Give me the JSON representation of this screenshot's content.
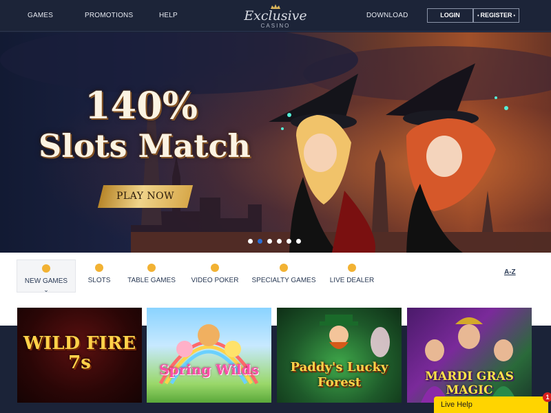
{
  "header": {
    "nav": [
      "GAMES",
      "PROMOTIONS",
      "HELP",
      "DOWNLOAD"
    ],
    "logo_main": "Exclusive",
    "logo_sub": "CASINO",
    "login_label": "LOGIN",
    "register_label": "REGISTER"
  },
  "hero": {
    "headline_1": "140%",
    "headline_2": "Slots Match",
    "cta_label": "PLAY NOW",
    "slide_count": 6,
    "active_slide": 2
  },
  "categories": {
    "items": [
      {
        "label": "NEW GAMES",
        "icon": "new-games-icon",
        "active": true
      },
      {
        "label": "SLOTS",
        "icon": "slots-icon"
      },
      {
        "label": "TABLE GAMES",
        "icon": "table-games-icon"
      },
      {
        "label": "VIDEO POKER",
        "icon": "video-poker-icon"
      },
      {
        "label": "SPECIALTY GAMES",
        "icon": "specialty-games-icon"
      },
      {
        "label": "LIVE DEALER",
        "icon": "live-dealer-icon"
      }
    ],
    "az_label": "A-Z"
  },
  "games": {
    "tiles": [
      {
        "name": "WILD FIRE 7s"
      },
      {
        "name": "Spring Wilds"
      },
      {
        "name": "Paddy's Lucky Forest"
      },
      {
        "name": "MARDI GRAS MAGIC"
      }
    ]
  },
  "live_help": {
    "label": "Live Help",
    "badge": "1"
  },
  "colors": {
    "accent_gold": "#f2b233",
    "active_dot": "#2a6fd6",
    "live_help_bg": "#ffd400",
    "header_bg": "#1c2438"
  }
}
